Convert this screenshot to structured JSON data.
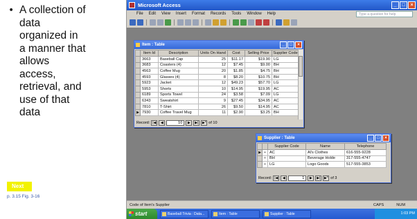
{
  "slide": {
    "bullet_lines": [
      "A collection of",
      "data",
      "organized in",
      "a manner that",
      "allows",
      "access,",
      "retrieval, and",
      "use of that",
      "data"
    ],
    "next_label": "Next",
    "page_ref": "p. 3.15 Fig. 3-16"
  },
  "app": {
    "title": "Microsoft Access",
    "menu": [
      "File",
      "Edit",
      "View",
      "Insert",
      "Format",
      "Records",
      "Tools",
      "Window",
      "Help"
    ],
    "help_placeholder": "Type a question for help",
    "status_text": "Code of Item's Supplier",
    "status_caps": "CAPS",
    "status_num": "NUM"
  },
  "item_table": {
    "title": "Item : Table",
    "columns": [
      "Item Id",
      "Description",
      "Units On Hand",
      "Cost",
      "Selling Price",
      "Supplier Code"
    ],
    "rows": [
      [
        "3663",
        "Baseball Cap",
        "25",
        "$11.17",
        "$19.90",
        "LG"
      ],
      [
        "3683",
        "Coasters (4)",
        "12",
        "$7.45",
        "$9.00",
        "BH"
      ],
      [
        "4563",
        "Coffee Mug",
        "20",
        "$1.85",
        "$4.75",
        "BH"
      ],
      [
        "4593",
        "Glasses (4)",
        "8",
        "$8.20",
        "$10.75",
        "BH"
      ],
      [
        "5923",
        "Jacket",
        "12",
        "$49.23",
        "$57.70",
        "LG"
      ],
      [
        "5953",
        "Shorts",
        "10",
        "$14.95",
        "$19.95",
        "AC"
      ],
      [
        "6189",
        "Sports Towel",
        "24",
        "$3.58",
        "$7.09",
        "LG"
      ],
      [
        "6343",
        "Sweatshirt",
        "9",
        "$27.45",
        "$34.95",
        "AC"
      ],
      [
        "7810",
        "T-Shirt",
        "26",
        "$9.50",
        "$14.95",
        "AC"
      ],
      [
        "7930",
        "Coffee Travel Mug",
        "11",
        "$2.90",
        "$3.25",
        "BH"
      ]
    ],
    "record_label": "Record:",
    "record_current": "10",
    "record_total": "of 10"
  },
  "supplier_table": {
    "title": "Supplier : Table",
    "columns": [
      "Supplier Code",
      "Name",
      "Telephone"
    ],
    "rows": [
      [
        "AC",
        "Al's Clothes",
        "616-555-9228"
      ],
      [
        "BH",
        "Beverage Holde",
        "317-555-4747"
      ],
      [
        "LG",
        "Logo Goods",
        "517-555-3853"
      ]
    ],
    "record_label": "Record:",
    "record_current": "1",
    "record_total": "of 3"
  },
  "taskbar": {
    "start_label": "start",
    "tasks": [
      "Baseball Trivia : Data...",
      "Item : Table",
      "Supplier : Table"
    ],
    "tray_time": "1:03 PM"
  }
}
